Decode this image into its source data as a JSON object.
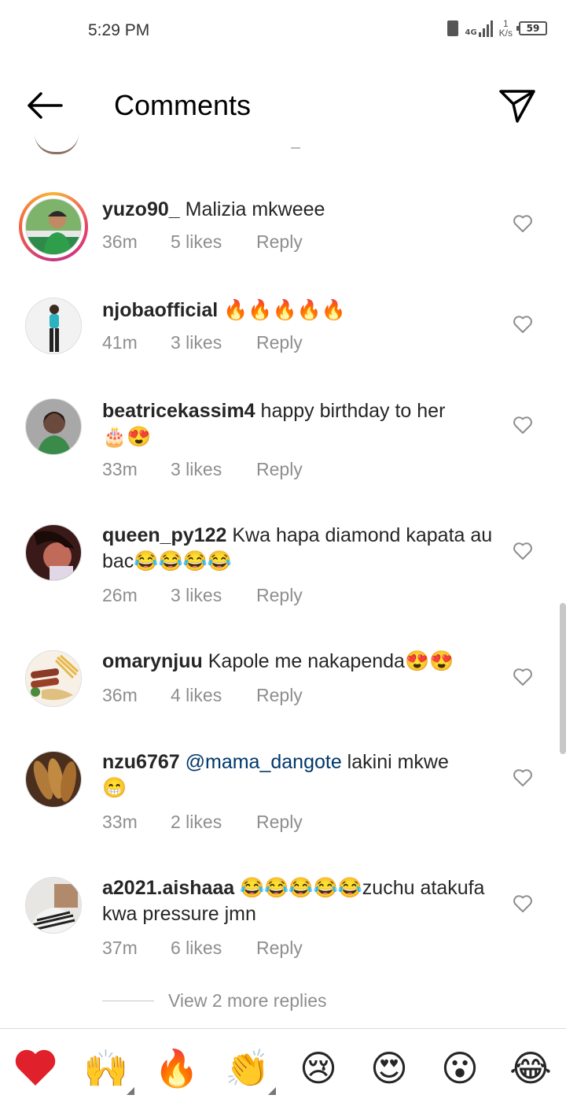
{
  "status_bar": {
    "time": "5:29 PM",
    "network": "4G",
    "speed_value": "1",
    "speed_unit": "K/s",
    "battery": "59"
  },
  "header": {
    "title": "Comments"
  },
  "comments": [
    {
      "username": "yuzo90_",
      "text": " Malizia mkweee",
      "time": "36m",
      "likes": "5 likes",
      "reply": "Reply",
      "emoji": ""
    },
    {
      "username": "njobaofficial",
      "text": " ",
      "time": "41m",
      "likes": "3 likes",
      "reply": "Reply",
      "emoji": "🔥🔥🔥🔥🔥"
    },
    {
      "username": "beatricekassim4",
      "text": " happy birthday to her",
      "time": "33m",
      "likes": "3 likes",
      "reply": "Reply",
      "emoji": "🎂😍"
    },
    {
      "username": "queen_py122",
      "text": " Kwa hapa diamond kapata au bac",
      "time": "26m",
      "likes": "3 likes",
      "reply": "Reply",
      "emoji": "😂😂😂😂"
    },
    {
      "username": "omarynjuu",
      "text": " Kapole me nakapenda",
      "time": "36m",
      "likes": "4 likes",
      "reply": "Reply",
      "emoji": "😍😍"
    },
    {
      "username": "nzu6767",
      "mention": " @mama_dangote",
      "text": " lakini mkwe",
      "time": "33m",
      "likes": "2 likes",
      "reply": "Reply",
      "emoji": "😁"
    },
    {
      "username": "a2021.aishaaa",
      "text": "zuchu atakufa kwa pressure jmn",
      "time": "37m",
      "likes": "6 likes",
      "reply": "Reply",
      "emoji": "😂😂😂😂😂"
    }
  ],
  "view_more_replies": "View 2 more replies",
  "emoji_bar": [
    {
      "emoji": "❤️",
      "name": "heart"
    },
    {
      "emoji": "🙌",
      "name": "raising-hands"
    },
    {
      "emoji": "🔥",
      "name": "fire"
    },
    {
      "emoji": "👏",
      "name": "clapping-hands"
    },
    {
      "emoji": "😢",
      "name": "crying-face"
    },
    {
      "emoji": "😍",
      "name": "heart-eyes"
    },
    {
      "emoji": "😮",
      "name": "surprised-face"
    },
    {
      "emoji": "😂",
      "name": "tears-of-joy"
    }
  ],
  "colors": {
    "text": "#262626",
    "secondary": "#8e8e8e",
    "mention": "#00376b",
    "story_ring_start": "#f8b53a",
    "story_ring_end": "#c13584"
  }
}
